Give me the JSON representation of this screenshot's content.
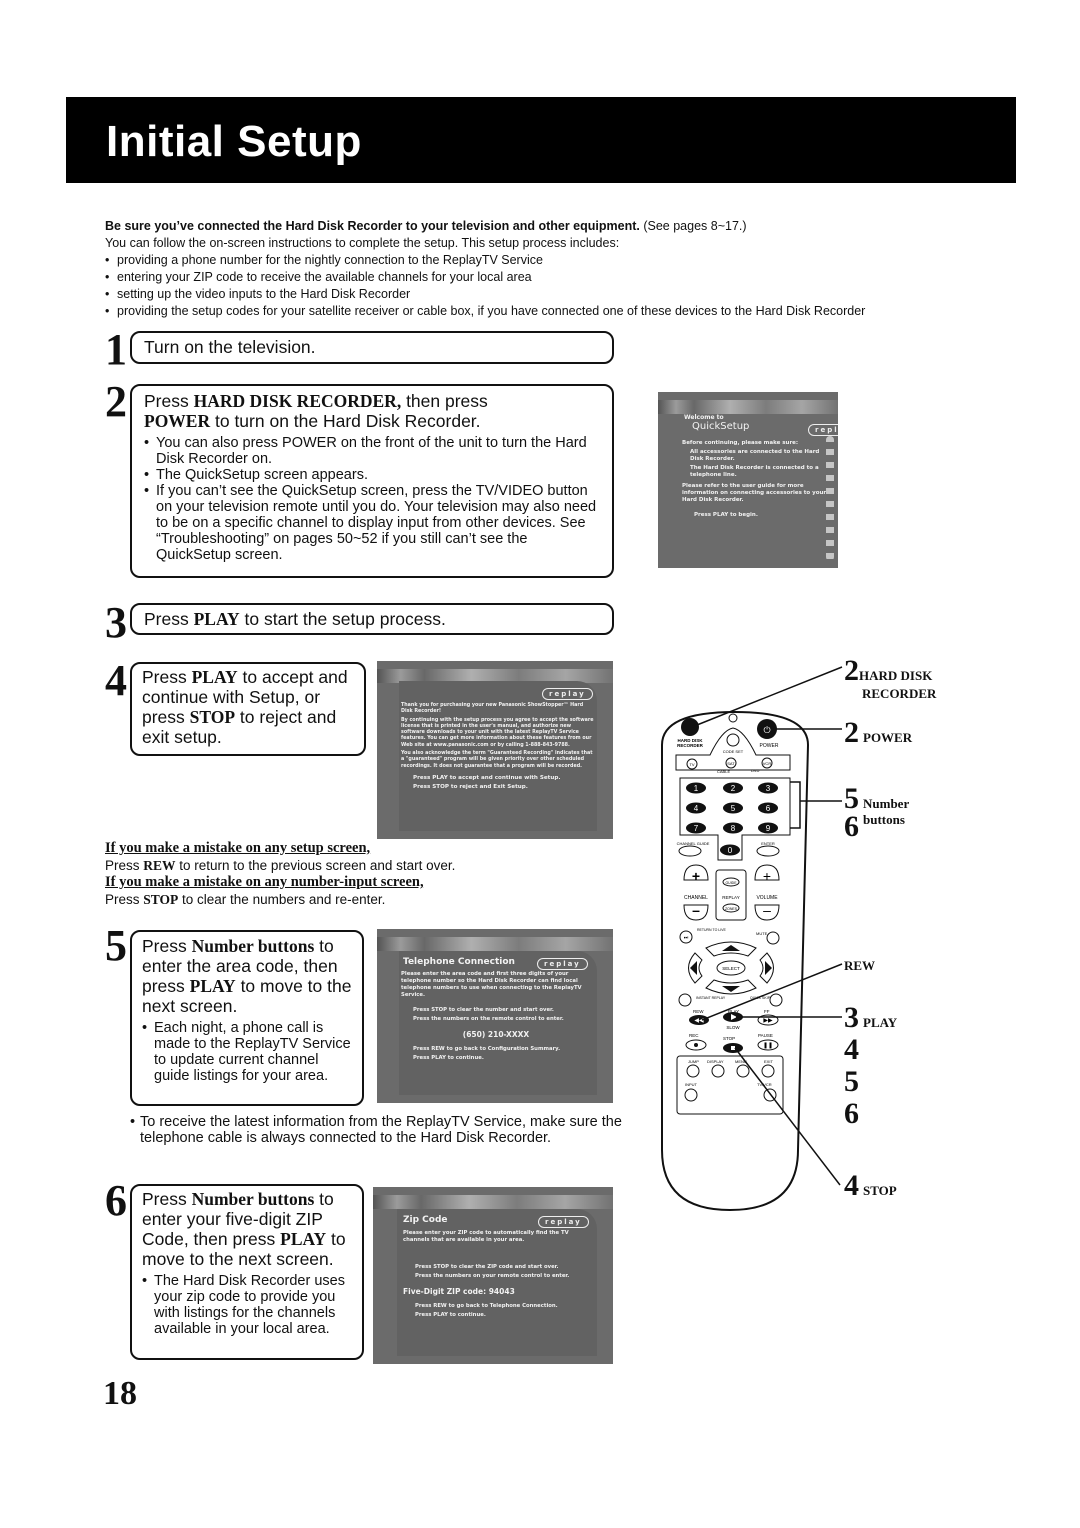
{
  "header": {
    "title": "Initial Setup"
  },
  "intro": {
    "bold_lead": "Be sure you’ve connected the Hard Disk Recorder to your television and other equipment.",
    "see_pages": "(See pages 8~17.)",
    "line2": "You can follow the on-screen instructions to complete the setup. This setup process includes:",
    "bullets": [
      "providing a phone number for the nightly connection to the ReplayTV Service",
      "entering your ZIP code to receive the available channels for your local area",
      "setting up the video inputs to the Hard Disk Recorder",
      "providing the setup codes for your satellite receiver or cable box, if you have connected one of these devices to the Hard Disk Recorder"
    ]
  },
  "steps": {
    "s1": {
      "num": "1",
      "text": "Turn on the television."
    },
    "s2": {
      "num": "2",
      "t_press": "Press ",
      "t_b1": "HARD DISK RECORDER,",
      "t_mid": " then press",
      "t_b2": "POWER",
      "t_end": " to turn on the Hard Disk Recorder.",
      "bullets": [
        "You can also press POWER on the front of the unit to turn the Hard Disk Recorder on.",
        "The QuickSetup screen appears.",
        "If you can’t see the QuickSetup screen, press the TV/VIDEO button on your television remote until you do. Your television may also need to be on a specific channel to display input from other devices. See “Troubleshooting” on pages 50~52 if you still can’t see the QuickSetup screen."
      ]
    },
    "s3": {
      "num": "3",
      "t_press": "Press ",
      "t_b": "PLAY",
      "t_end": " to start the setup process."
    },
    "s4": {
      "num": "4",
      "t_press": "Press ",
      "t_b1": "PLAY",
      "t_mid": " to accept and continue with Setup, or press ",
      "t_b2": "STOP",
      "t_end": " to reject and exit setup."
    },
    "s5": {
      "num": "5",
      "t_press": "Press ",
      "t_b1": "Number buttons",
      "t_mid": " to enter the area code, then press ",
      "t_b2": "PLAY",
      "t_end": " to move to the next screen.",
      "bullets": [
        "Each night, a phone call is made to the ReplayTV Service to update current channel guide listings for your area."
      ],
      "after": "To receive the latest information from the ReplayTV Service, make sure the telephone cable is always connected to the Hard Disk Recorder."
    },
    "s6": {
      "num": "6",
      "t_press": "Press ",
      "t_b1": "Number buttons",
      "t_mid": " to enter your five-digit ZIP Code, then press ",
      "t_b2": "PLAY",
      "t_end": " to move to the next screen.",
      "bullets": [
        "The Hard Disk Recorder uses your zip code to provide you with listings for the channels available in your local area."
      ]
    }
  },
  "mistakes": {
    "h1": "If you make a mistake on any setup screen,",
    "p1_a": "Press ",
    "p1_b": "REW",
    "p1_c": " to return to the previous screen and start over.",
    "h2": "If you make a mistake on any number-input screen,",
    "p2_a": "Press ",
    "p2_b": "STOP",
    "p2_c": " to clear the numbers and re-enter."
  },
  "screens": {
    "logo": "replay",
    "quicksetup": {
      "welcome": "Welcome to",
      "title": "QuickSetup",
      "lead": "Before continuing, please make sure:",
      "items": [
        "All accessories are connected to the Hard Disk Recorder.",
        "The Hard Disk Recorder is connected to a telephone line."
      ],
      "refer": "Please refer to the user guide for more information on connecting accessories to your Hard Disk Recorder.",
      "action": "Press PLAY to begin."
    },
    "license": {
      "p1": "Thank you for purchasing your new Panasonic ShowStopper™ Hard Disk Recorder!",
      "p2": "By continuing with the setup process you agree to accept the software license that is printed in the user's manual, and authorize new software downloads to your unit with the latest ReplayTV Service features. You can get more information about these features from our Web site at www.panasonic.com or by calling 1-888-843-9788.",
      "p3": "You also acknowledge the term \"Guaranteed Recording\" indicates that a \"guaranteed\" program will be given priority over other scheduled recordings. It does not guarantee that a program will be recorded.",
      "a1": "Press PLAY to accept and continue with Setup.",
      "a2": "Press STOP to reject and Exit Setup."
    },
    "telephone": {
      "title": "Telephone Connection",
      "p1": "Please enter the area code and first three digits of your telephone number so the Hard Disk Recorder can find local telephone numbers to use when connecting to the ReplayTV Service.",
      "i1": "Press STOP to clear the number and start over.",
      "i2": "Press the numbers on the remote control to enter.",
      "value": "(650) 210-XXXX",
      "n1": "Press REW to go back to Configuration Summary.",
      "n2": "Press PLAY to continue."
    },
    "zip": {
      "title": "Zip Code",
      "p1": "Please enter your ZIP code to automatically find the TV channels that are available in your area.",
      "i1": "Press STOP to clear the ZIP code and start over.",
      "i2": "Press the numbers on your remote control to enter.",
      "value_label": "Five-Digit ZIP code: 94043",
      "n1": "Press REW to go back to Telephone Connection.",
      "n2": "Press PLAY to continue."
    }
  },
  "remote": {
    "labels": {
      "hdr": "HARD DISK RECORDER",
      "power": "POWER",
      "codeset": "CODE SET",
      "tv": "TV",
      "sat": "SAT",
      "vcr": "VCR",
      "cable": "CABLE",
      "dvd": "DVD",
      "digits": [
        "1",
        "2",
        "3",
        "4",
        "5",
        "6",
        "7",
        "8",
        "9",
        "0"
      ],
      "chguide": "CHANNEL GUIDE",
      "enter": "ENTER",
      "channel": "CHANNEL",
      "replay": "REPLAY",
      "volume": "VOLUME",
      "guide": "GUIDE",
      "zones": "ZONES",
      "return": "RETURN TO LIVE",
      "mute": "MUTE",
      "select": "SELECT",
      "instant": "INSTANT REPLAY",
      "quickskip": "QUICK SKIP",
      "rew": "REW",
      "play": "PLAY",
      "ff": "FF",
      "slow": "SLOW",
      "rec": "REC",
      "stop": "STOP",
      "pause": "PAUSE",
      "jump": "JUMP",
      "display": "DISPLAY",
      "menu": "MENU",
      "exit": "EXIT",
      "input": "INPUT",
      "tvvcr": "TV/VCR"
    },
    "callouts": {
      "hdr_num": "2",
      "hdr_l1": "HARD DISK",
      "hdr_l2": "RECORDER",
      "pow_num": "2",
      "pow_l": "POWER",
      "num_n1": "5",
      "num_n2": "6",
      "num_l1": "Number",
      "num_l2": "buttons",
      "rew_l": "REW",
      "play_nums": [
        "3",
        "4",
        "5",
        "6"
      ],
      "play_l": "PLAY",
      "stop_num": "4",
      "stop_l": "STOP"
    }
  },
  "page_number": "18"
}
